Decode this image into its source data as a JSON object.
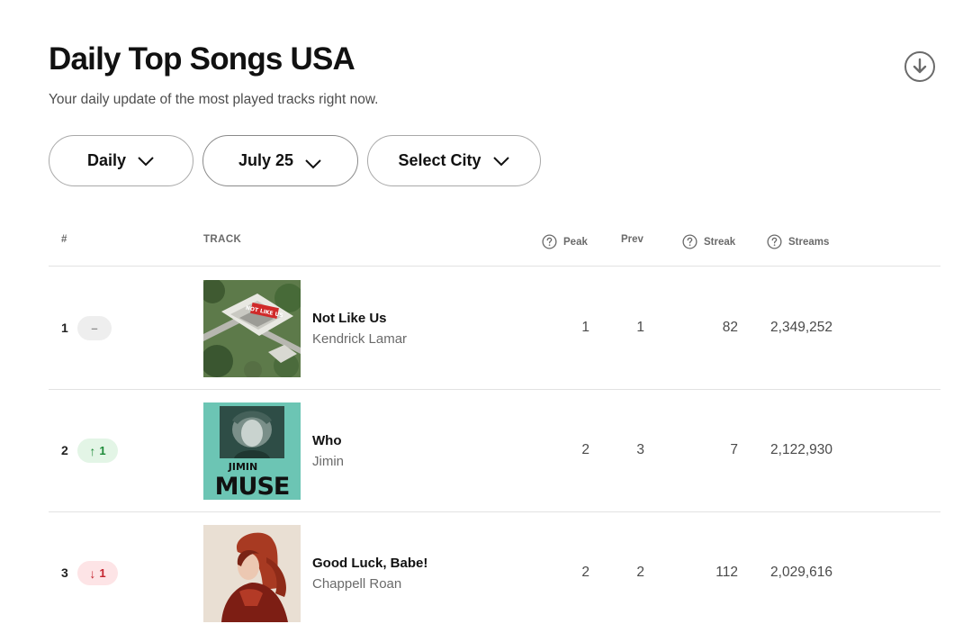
{
  "header": {
    "title": "Daily Top Songs USA",
    "subtitle": "Your daily update of the most played tracks right now."
  },
  "filters": {
    "period": "Daily",
    "date": "July 25",
    "city": "Select City"
  },
  "table": {
    "columns": {
      "rank": "#",
      "track": "TRACK",
      "peak": "Peak",
      "prev": "Prev",
      "streak": "Streak",
      "streams": "Streams"
    },
    "rows": [
      {
        "rank": "1",
        "change": "–",
        "change_dir": "same",
        "title": "Not Like Us",
        "artist": "Kendrick Lamar",
        "peak": "1",
        "prev": "1",
        "streak": "82",
        "streams": "2,349,252"
      },
      {
        "rank": "2",
        "change": "1",
        "change_dir": "up",
        "title": "Who",
        "artist": "Jimin",
        "peak": "2",
        "prev": "3",
        "streak": "7",
        "streams": "2,122,930"
      },
      {
        "rank": "3",
        "change": "1",
        "change_dir": "down",
        "title": "Good Luck, Babe!",
        "artist": "Chappell Roan",
        "peak": "2",
        "prev": "2",
        "streak": "112",
        "streams": "2,029,616"
      }
    ]
  },
  "album_art": {
    "row1_text": "NOT LIKE US",
    "row2_top_text": "JIMIN",
    "row2_text": "MUSE"
  },
  "colors": {
    "up": "#1e8a39",
    "down": "#c4242f",
    "muse_bg": "#6cc5b4"
  }
}
